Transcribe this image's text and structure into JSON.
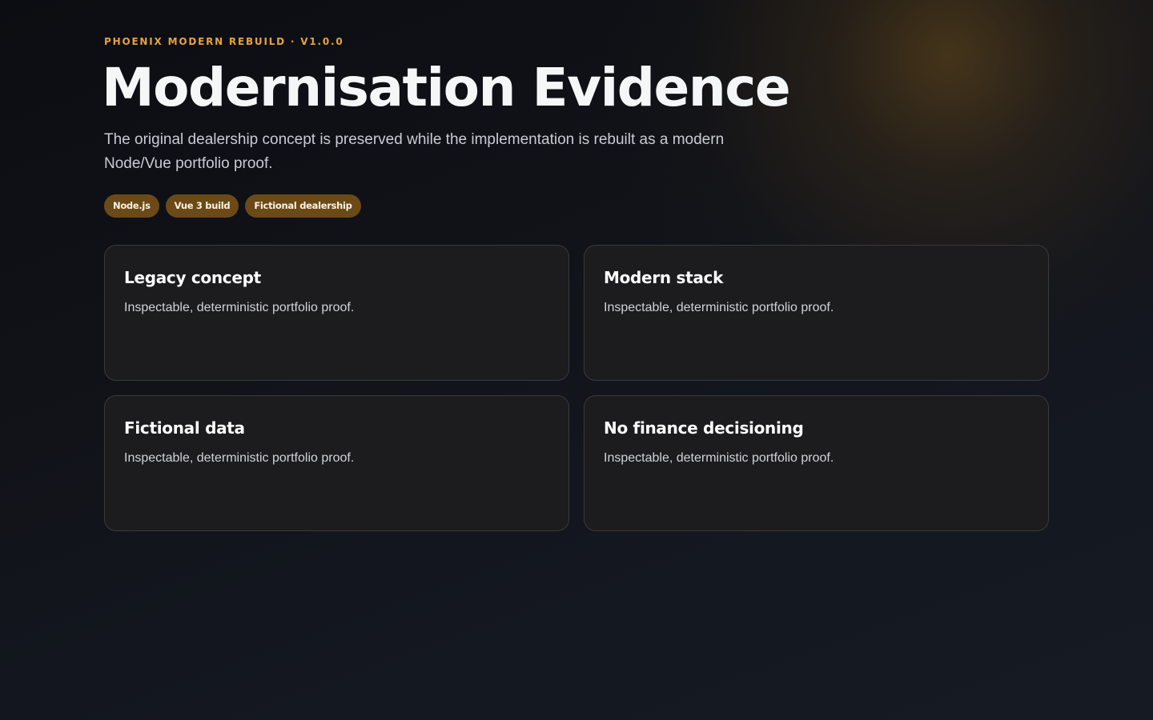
{
  "header": {
    "eyebrow": "PHOENIX MODERN REBUILD · V1.0.0",
    "title": "Modernisation Evidence",
    "lead": "The original dealership concept is preserved while the implementation is rebuilt as a modern Node/Vue portfolio proof."
  },
  "tags": [
    {
      "label": "Node.js"
    },
    {
      "label": "Vue 3 build"
    },
    {
      "label": "Fictional dealership"
    }
  ],
  "cards": [
    {
      "title": "Legacy concept",
      "text": "Inspectable, deterministic portfolio proof."
    },
    {
      "title": "Modern stack",
      "text": "Inspectable, deterministic portfolio proof."
    },
    {
      "title": "Fictional data",
      "text": "Inspectable, deterministic portfolio proof."
    },
    {
      "title": "No finance decisioning",
      "text": "Inspectable, deterministic portfolio proof."
    }
  ],
  "colors": {
    "accent": "#e8a23b",
    "tag_background": "#6b4a18",
    "card_background": "#1c1c1e",
    "card_border": "#3a3a3c"
  }
}
